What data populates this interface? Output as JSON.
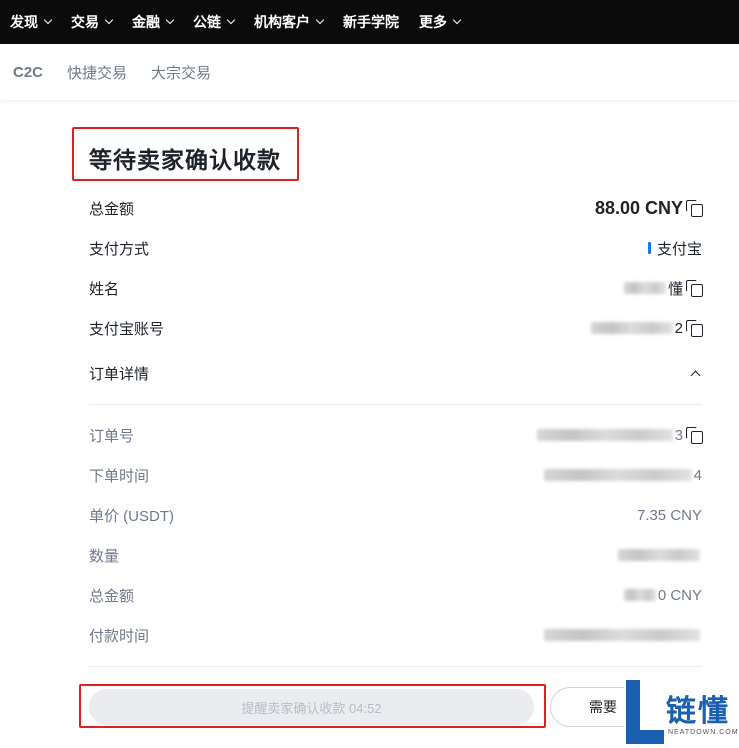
{
  "nav": {
    "items": [
      {
        "label": "发现"
      },
      {
        "label": "交易"
      },
      {
        "label": "金融"
      },
      {
        "label": "公链"
      },
      {
        "label": "机构客户"
      },
      {
        "label": "新手学院"
      },
      {
        "label": "更多"
      }
    ]
  },
  "subnav": {
    "items": [
      {
        "label": "C2C"
      },
      {
        "label": "快捷交易"
      },
      {
        "label": "大宗交易"
      }
    ]
  },
  "order": {
    "title": "等待卖家确认收款",
    "total_label": "总金额",
    "total_value": "88.00 CNY",
    "payment_method_label": "支付方式",
    "payment_method_value": "支付宝",
    "name_label": "姓名",
    "name_value_visible": "懂",
    "account_label": "支付宝账号",
    "account_value_visible": "2",
    "details_label": "订单详情"
  },
  "details": {
    "order_no_label": "订单号",
    "order_no_visible": "3",
    "created_label": "下单时间",
    "created_visible": "4",
    "unit_price_label": "单价 (USDT)",
    "unit_price_value": "7.35 CNY",
    "quantity_label": "数量",
    "detail_total_label": "总金额",
    "detail_total_visible": "0 CNY",
    "paid_time_label": "付款时间"
  },
  "actions": {
    "remind_label": "提醒卖家确认收款 04:52",
    "other_label": "需要"
  },
  "watermark": {
    "text": "链懂",
    "sub": "NEATDOWN.COM"
  },
  "colors": {
    "nav_bg": "#0b0b0b",
    "highlight_box": "#e02020",
    "alipay_blue": "#1677ff",
    "watermark_blue": "#1b5fb0"
  }
}
